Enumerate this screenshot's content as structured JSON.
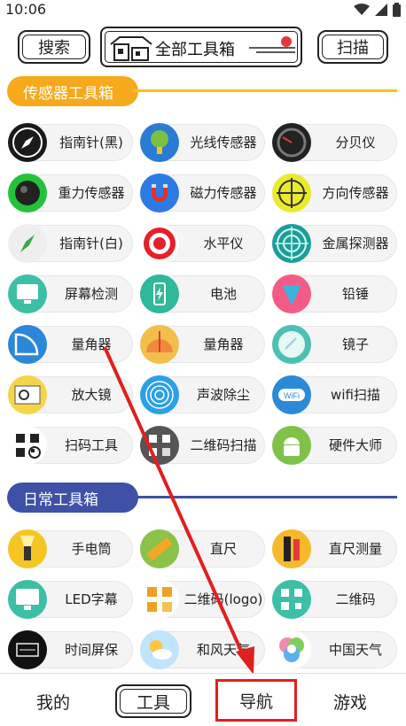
{
  "status_bar": {
    "time": "10:06",
    "icons": [
      "wifi-icon",
      "signal-icon",
      "battery-icon"
    ]
  },
  "header": {
    "search_label": "搜索",
    "title": "全部工具箱",
    "scan_label": "扫描"
  },
  "sections": [
    {
      "label": "传感器工具箱",
      "color": "#f6a91b"
    },
    {
      "label": "日常工具箱",
      "color": "#3e51a7"
    }
  ],
  "sensor_tools": [
    {
      "label": "指南针(黑)",
      "icon": "compass-black-icon"
    },
    {
      "label": "光线传感器",
      "icon": "light-sensor-icon"
    },
    {
      "label": "分贝仪",
      "icon": "decibel-meter-icon"
    },
    {
      "label": "重力传感器",
      "icon": "gravity-sensor-icon"
    },
    {
      "label": "磁力传感器",
      "icon": "magnet-icon"
    },
    {
      "label": "方向传感器",
      "icon": "direction-sensor-icon"
    },
    {
      "label": "指南针(白)",
      "icon": "compass-white-icon"
    },
    {
      "label": "水平仪",
      "icon": "level-icon"
    },
    {
      "label": "金属探测器",
      "icon": "metal-detector-icon"
    },
    {
      "label": "屏幕检测",
      "icon": "screen-test-icon"
    },
    {
      "label": "电池",
      "icon": "battery-tool-icon"
    },
    {
      "label": "铅锤",
      "icon": "plumb-icon"
    },
    {
      "label": "量角器",
      "icon": "protractor-icon"
    },
    {
      "label": "量角器",
      "icon": "protractor-2-icon"
    },
    {
      "label": "镜子",
      "icon": "mirror-icon"
    },
    {
      "label": "放大镜",
      "icon": "magnifier-icon"
    },
    {
      "label": "声波除尘",
      "icon": "sonic-clean-icon"
    },
    {
      "label": "wifi扫描",
      "icon": "wifi-scan-icon"
    },
    {
      "label": "扫码工具",
      "icon": "qr-scan-tool-icon"
    },
    {
      "label": "二维码扫描",
      "icon": "qr-code-scan-icon"
    },
    {
      "label": "硬件大师",
      "icon": "android-hardware-icon"
    }
  ],
  "daily_tools": [
    {
      "label": "手电筒",
      "icon": "flashlight-icon"
    },
    {
      "label": "直尺",
      "icon": "ruler-icon"
    },
    {
      "label": "直尺测量",
      "icon": "ruler-measure-icon"
    },
    {
      "label": "LED字幕",
      "icon": "led-monitor-icon"
    },
    {
      "label": "二维码(logo)",
      "icon": "qr-logo-icon"
    },
    {
      "label": "二维码",
      "icon": "qr-code-icon"
    },
    {
      "label": "时间屏保",
      "icon": "clock-screensaver-icon"
    },
    {
      "label": "和风天气",
      "icon": "weather-icon"
    },
    {
      "label": "中国天气",
      "icon": "china-weather-icon"
    }
  ],
  "bottom_nav": {
    "mine": "我的",
    "tools": "工具",
    "navigation": "导航",
    "games": "游戏"
  },
  "annotation": {
    "highlight_color": "#e0201f"
  }
}
